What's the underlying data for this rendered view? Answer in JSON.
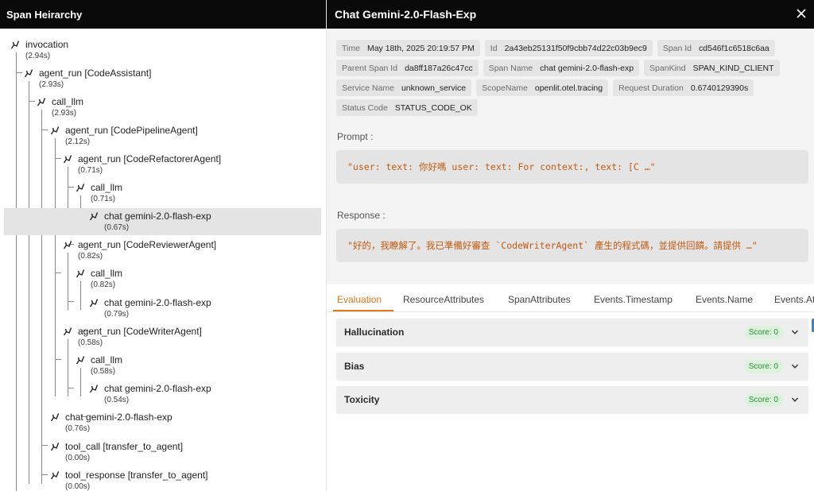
{
  "left_panel": {
    "title": "Span Heirarchy",
    "nodes": [
      {
        "name": "invocation",
        "duration": "(2.94s)"
      },
      {
        "name": "agent_run [CodeAssistant]",
        "duration": "(2.93s)"
      },
      {
        "name": "call_llm",
        "duration": "(2.93s)"
      },
      {
        "name": "agent_run [CodePipelineAgent]",
        "duration": "(2.12s)"
      },
      {
        "name": "agent_run [CodeRefactorerAgent]",
        "duration": "(0.71s)"
      },
      {
        "name": "call_llm",
        "duration": "(0.71s)"
      },
      {
        "name": "chat gemini-2.0-flash-exp",
        "duration": "(0.67s)"
      },
      {
        "name": "agent_run [CodeReviewerAgent]",
        "duration": "(0.82s)"
      },
      {
        "name": "call_llm",
        "duration": "(0.82s)"
      },
      {
        "name": "chat gemini-2.0-flash-exp",
        "duration": "(0.79s)"
      },
      {
        "name": "agent_run [CodeWriterAgent]",
        "duration": "(0.58s)"
      },
      {
        "name": "call_llm",
        "duration": "(0.58s)"
      },
      {
        "name": "chat gemini-2.0-flash-exp",
        "duration": "(0.54s)"
      },
      {
        "name": "chat gemini-2.0-flash-exp",
        "duration": "(0.76s)"
      },
      {
        "name": "tool_call [transfer_to_agent]",
        "duration": "(0.00s)"
      },
      {
        "name": "tool_response [transfer_to_agent]",
        "duration": "(0.00s)"
      }
    ]
  },
  "detail": {
    "title": "Chat Gemini-2.0-Flash-Exp",
    "attributes": [
      [
        {
          "key": "Time",
          "value": "May 18th, 2025 20:19:57 PM"
        },
        {
          "key": "Id",
          "value": "2a43eb25131f50f9cbb74d22c03b9ec9"
        },
        {
          "key": "Span Id",
          "value": "cd546f1c6518c6aa"
        }
      ],
      [
        {
          "key": "Parent Span Id",
          "value": "da8ff187a26c47cc"
        },
        {
          "key": "Span Name",
          "value": "chat gemini-2.0-flash-exp"
        },
        {
          "key": "SpanKind",
          "value": "SPAN_KIND_CLIENT"
        }
      ],
      [
        {
          "key": "Service Name",
          "value": "unknown_service"
        },
        {
          "key": "ScopeName",
          "value": "openlit.otel.tracing"
        },
        {
          "key": "Request Duration",
          "value": "0.6740129390s"
        }
      ],
      [
        {
          "key": "Status Code",
          "value": "STATUS_CODE_OK"
        }
      ]
    ],
    "prompt_label": "Prompt :",
    "prompt_text": "\"user: text: 你好嗎 user: text: For context:, text: [C …\"",
    "response_label": "Response :",
    "response_text": "\"好的，我瞭解了。我已準備好審查 `CodeWriterAgent` 產生的程式碼，並提供回饋。請提供 …\""
  },
  "tabs": [
    {
      "label": "Evaluation",
      "active": true
    },
    {
      "label": "ResourceAttributes",
      "active": false
    },
    {
      "label": "SpanAttributes",
      "active": false
    },
    {
      "label": "Events.Timestamp",
      "active": false
    },
    {
      "label": "Events.Name",
      "active": false
    },
    {
      "label": "Events.At",
      "active": false
    }
  ],
  "evaluations": [
    {
      "name": "Hallucination",
      "score": "Score: 0"
    },
    {
      "name": "Bias",
      "score": "Score: 0"
    },
    {
      "name": "Toxicity",
      "score": "Score: 0"
    }
  ],
  "icons": {
    "span": "branch-icon",
    "close": "close-icon",
    "expand": "chevron-down-icon"
  },
  "colors": {
    "header_bg": "#0a0a0a",
    "accent": "#e2761b",
    "code_text": "#c25a12",
    "score_text": "#2e8b3a",
    "score_bg": "#dcf2dc",
    "selected_row": "#e4e4e4"
  }
}
